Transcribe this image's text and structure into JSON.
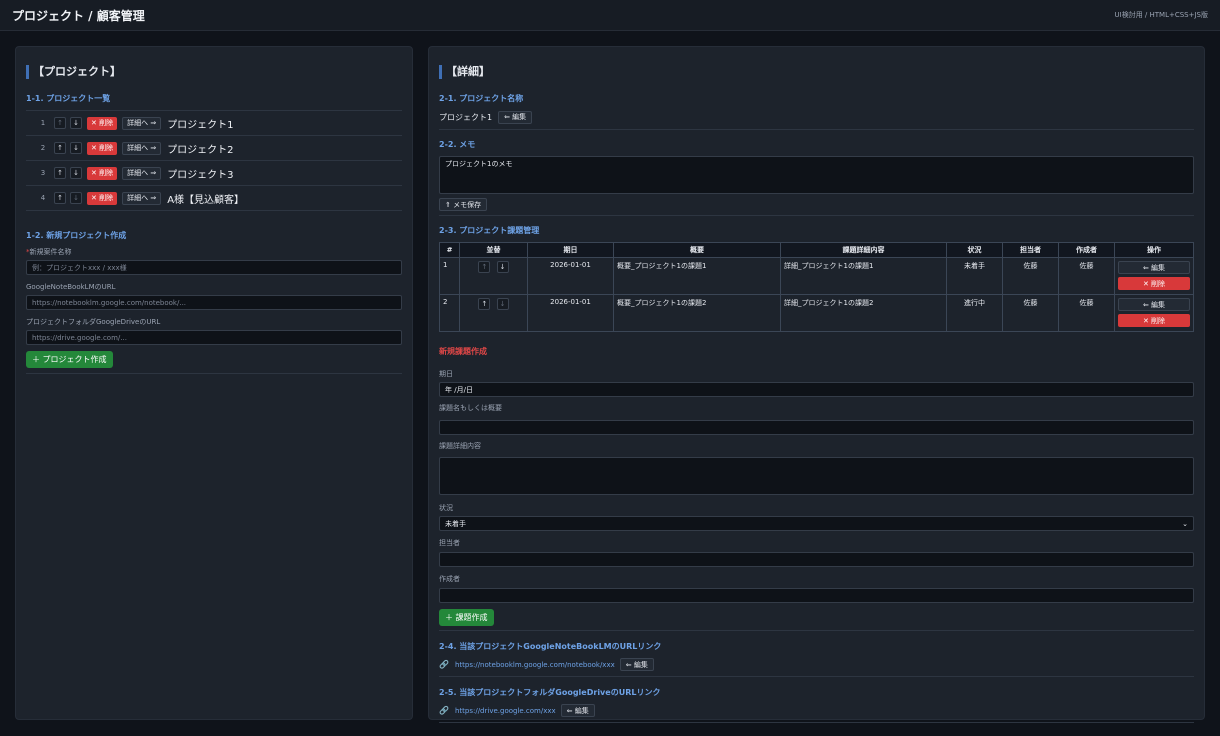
{
  "header": {
    "title": "プロジェクト / 顧客管理",
    "subtitle": "UI検討用 / HTML+CSS+JS版"
  },
  "left": {
    "title": "【プロジェクト】",
    "list_title": "1-1. プロジェクト一覧",
    "up": "↑",
    "down": "↓",
    "delete_label": "✕ 削除",
    "detail_label": "詳細へ ⇒",
    "projects": [
      {
        "num": "1",
        "name": "プロジェクト1"
      },
      {
        "num": "2",
        "name": "プロジェクト2"
      },
      {
        "num": "3",
        "name": "プロジェクト3"
      },
      {
        "num": "4",
        "name": "A様【見込顧客】"
      }
    ],
    "new_title": "1-2. 新規プロジェクト作成",
    "required_mark": "*",
    "name_label": "新規案件名称",
    "name_placeholder": "例：プロジェクトxxx / xxx様",
    "notebook_label": "GoogleNoteBookLMのURL",
    "notebook_placeholder": "https://notebooklm.google.com/notebook/...",
    "drive_label": "プロジェクトフォルダGoogleDriveのURL",
    "drive_placeholder": "https://drive.google.com/...",
    "create_button": "＋ プロジェクト作成"
  },
  "right": {
    "title": "【詳細】",
    "name_section": "2-1. プロジェクト名称",
    "project_name": "プロジェクト1",
    "edit_label": "⇐ 編集",
    "memo_section": "2-2. メモ",
    "memo_text": "プロジェクト1のメモ",
    "memo_save": "⇑ メモ保存",
    "issues_section": "2-3. プロジェクト課題管理",
    "columns": [
      "#",
      "並替",
      "期日",
      "概要",
      "課題詳細内容",
      "状況",
      "担当者",
      "作成者",
      "操作"
    ],
    "rows": [
      {
        "num": "1",
        "date": "2026-01-01",
        "summary": "概要_プロジェクト1の課題1",
        "detail": "詳細_プロジェクト1の課題1",
        "status": "未着手",
        "assignee": "佐藤",
        "creator": "佐藤"
      },
      {
        "num": "2",
        "date": "2026-01-01",
        "summary": "概要_プロジェクト1の課題2",
        "detail": "詳細_プロジェクト1の課題2",
        "status": "進行中",
        "assignee": "佐藤",
        "creator": "佐藤"
      }
    ],
    "op_edit": "⇐ 編集",
    "op_delete": "✕ 削除",
    "new_issue_title": "新規課題作成",
    "due_label": "期日",
    "due_value": "年 /月/日",
    "summary_label": "課題名もしくは概要",
    "detail_label": "課題詳細内容",
    "status_label": "状況",
    "status_value": "未着手",
    "assignee_label": "担当者",
    "creator_label": "作成者",
    "create_issue_button": "＋ 課題作成",
    "notebook_section": "2-4. 当該プロジェクトGoogleNoteBookLMのURLリンク",
    "notebook_url": "https://notebooklm.google.com/notebook/xxx",
    "drive_section": "2-5. 当該プロジェクトフォルダGoogleDriveのURLリンク",
    "drive_url": "https://drive.google.com/xxx"
  }
}
